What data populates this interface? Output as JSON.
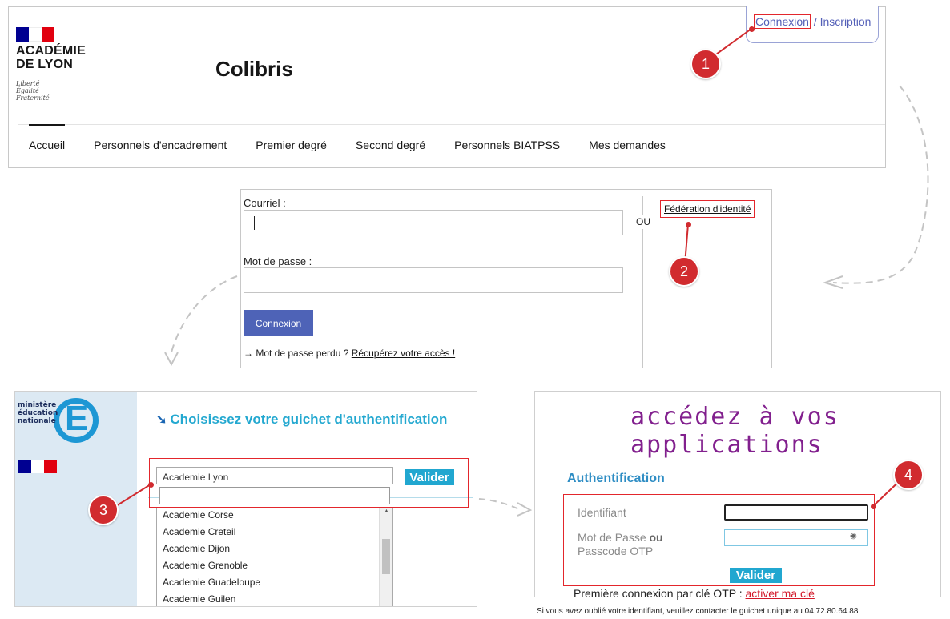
{
  "colibris": {
    "flag_colors": [
      "#000091",
      "#ffffff",
      "#e1000f"
    ],
    "org_line1": "ACADÉMIE",
    "org_line2": "DE LYON",
    "motto": [
      "Liberté",
      "Égalité",
      "Fraternité"
    ],
    "site_title": "Colibris",
    "connexion_label": "Connexion",
    "separator": "/",
    "inscription_label": "Inscription",
    "nav": [
      {
        "label": "Accueil",
        "active": true
      },
      {
        "label": "Personnels d'encadrement"
      },
      {
        "label": "Premier degré"
      },
      {
        "label": "Second degré"
      },
      {
        "label": "Personnels BIATPSS"
      },
      {
        "label": "Mes demandes"
      }
    ]
  },
  "login_form": {
    "email_label": "Courriel :",
    "password_label": "Mot de passe :",
    "or_label": "OU",
    "federation_link": "Fédération d'identité",
    "submit_label": "Connexion",
    "lost_prefix": "→ Mot de passe perdu ?",
    "lost_link": "Récupérez votre accès !"
  },
  "guichet": {
    "ministry_lines": [
      "ministère",
      "éducation",
      "nationale"
    ],
    "title": "Choisissez votre guichet d'authentification",
    "selected": "Academie Lyon",
    "search_value": "",
    "valider_label": "Valider",
    "options": [
      "Academie Corse",
      "Academie Creteil",
      "Academie Dijon",
      "Academie Grenoble",
      "Academie Guadeloupe",
      "Academie Guilen"
    ],
    "accent_color": "#21a7d0"
  },
  "portal": {
    "hero": "accédez à vos applications",
    "auth_title": "Authentification",
    "identifiant_label": "Identifiant",
    "password_label_prefix": "Mot de Passe",
    "password_label_or": "ou",
    "password_label_suffix": "Passcode OTP",
    "valider_label": "Valider",
    "first_login_text": "Première connexion par clé OTP :",
    "first_login_link": "activer ma clé",
    "forgot_text": "Si vous avez oublié votre identifiant, veuillez contacter le guichet unique au 04.72.80.64.88",
    "hero_color": "#82208e"
  },
  "annotations": {
    "step_1": "1",
    "step_2": "2",
    "step_3": "3",
    "step_4": "4",
    "color": "#d12b2f"
  }
}
